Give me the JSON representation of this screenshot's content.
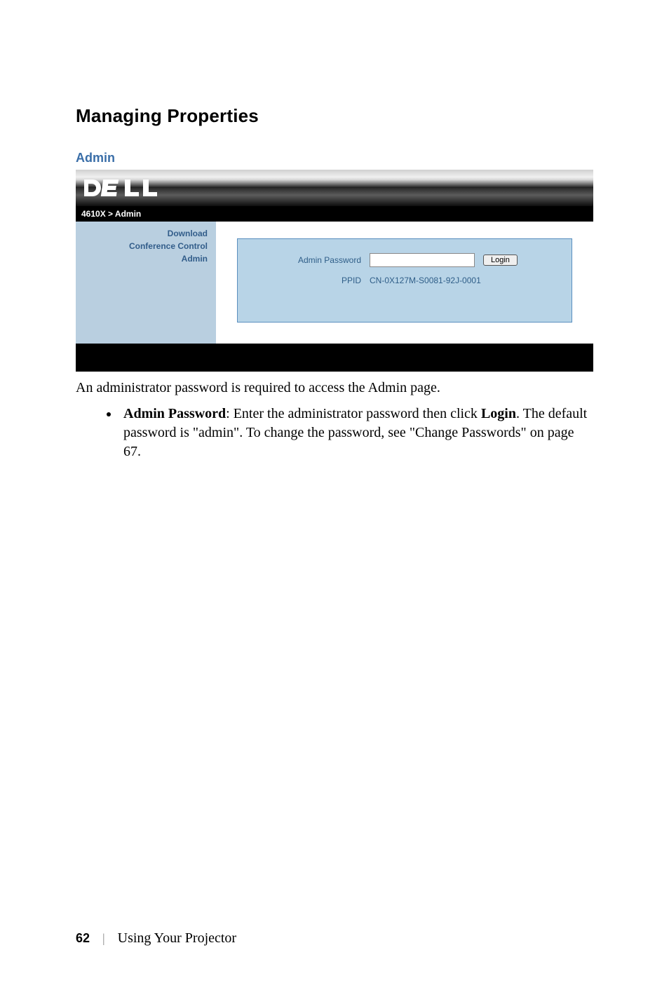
{
  "heading": "Managing Properties",
  "subheading": "Admin",
  "screenshot": {
    "breadcrumb": "4610X > Admin",
    "sidebar": {
      "items": [
        "Download",
        "Conference Control",
        "Admin"
      ]
    },
    "form": {
      "admin_password_label": "Admin Password",
      "admin_password_value": "",
      "login_button": "Login",
      "ppid_label": "PPID",
      "ppid_value": "CN-0X127M-S0081-92J-0001"
    }
  },
  "body_text": "An administrator password is required to access the Admin page.",
  "bullet": {
    "term": "Admin Password",
    "sep": ": ",
    "rest_before_login": "Enter the administrator password then click ",
    "login_word": "Login",
    "rest_after_login": ". The default password is \"admin\". To change the password, see \"Change Passwords\" on page 67."
  },
  "footer": {
    "page_num": "62",
    "text": "Using Your Projector"
  }
}
